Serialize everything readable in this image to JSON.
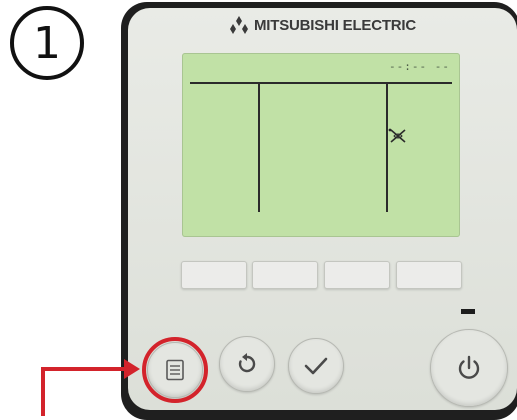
{
  "step": {
    "number": "1"
  },
  "brand": {
    "name": "MITSUBISHI ELECTRIC",
    "logo": "three-diamond-logo"
  },
  "screen": {
    "clock": "--:-- --",
    "icons": [
      "fan-swing-icon"
    ]
  },
  "function_keys": [
    "",
    "",
    "",
    ""
  ],
  "buttons": {
    "menu": {
      "icon": "menu-list-icon"
    },
    "return": {
      "icon": "return-arrow-icon"
    },
    "confirm": {
      "icon": "checkmark-icon"
    },
    "power": {
      "icon": "power-icon"
    }
  },
  "highlight": {
    "target": "menu-button",
    "color": "#d3232b"
  },
  "colors": {
    "lcd": "#c1e1a6",
    "panel": "#e4e6e1",
    "accent": "#d3232b"
  }
}
